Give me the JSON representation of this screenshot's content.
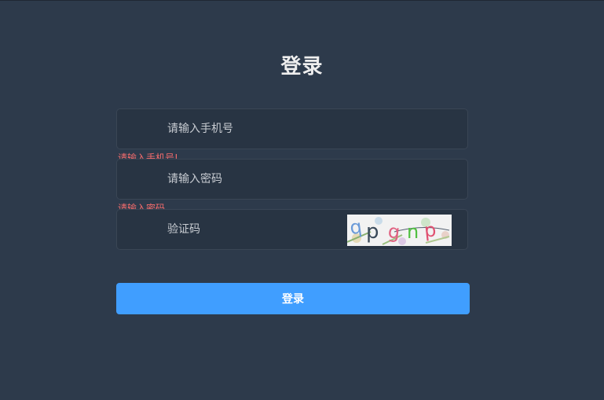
{
  "form": {
    "title": "登录",
    "phone": {
      "placeholder": "请输入手机号",
      "value": "",
      "error": "请输入手机号!"
    },
    "password": {
      "placeholder": "请输入密码",
      "value": "",
      "error": "请输入密码"
    },
    "captcha": {
      "placeholder": "验证码",
      "value": "",
      "image_text": "qpgnp"
    },
    "submit_label": "登录"
  },
  "colors": {
    "background": "#2d3a4b",
    "field_bg": "#283443",
    "error": "#f56c6c",
    "primary": "#409eff"
  }
}
